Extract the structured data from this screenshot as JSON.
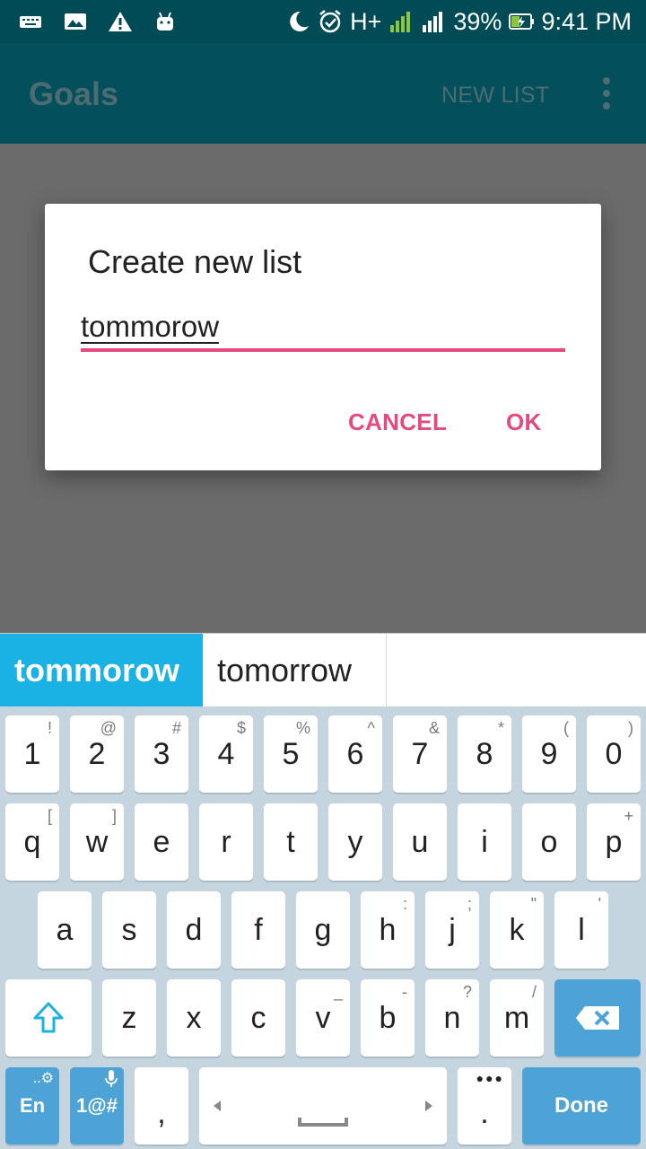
{
  "status_bar": {
    "battery": "39%",
    "time": "9:41 PM",
    "network": "H+",
    "sim1": "1",
    "sim2": "2",
    "icons_left": [
      "keyboard-icon",
      "image-icon",
      "warning-icon",
      "android-icon"
    ],
    "icons_right": [
      "moon-icon",
      "alarm-icon",
      "network-type-icon",
      "signal-icon",
      "signal-icon",
      "battery-charging-icon"
    ]
  },
  "app_bar": {
    "title": "Goals",
    "action": "NEW LIST",
    "menu_icon": "more-vert-icon"
  },
  "dialog": {
    "title": "Create new list",
    "input_value": "tommorow",
    "cancel_label": "CANCEL",
    "ok_label": "OK",
    "accent_color": "#e64980"
  },
  "suggestions": {
    "items": [
      "tommorow",
      "tomorrow"
    ],
    "highlight_color": "#1ab2e4"
  },
  "keyboard": {
    "row_numbers": [
      {
        "label": "1",
        "alt": "!"
      },
      {
        "label": "2",
        "alt": "@"
      },
      {
        "label": "3",
        "alt": "#"
      },
      {
        "label": "4",
        "alt": "$"
      },
      {
        "label": "5",
        "alt": "%"
      },
      {
        "label": "6",
        "alt": "^"
      },
      {
        "label": "7",
        "alt": "&"
      },
      {
        "label": "8",
        "alt": "*"
      },
      {
        "label": "9",
        "alt": "("
      },
      {
        "label": "0",
        "alt": ")"
      }
    ],
    "row_top": [
      {
        "label": "q",
        "alt": "["
      },
      {
        "label": "w",
        "alt": "]"
      },
      {
        "label": "e",
        "alt": ""
      },
      {
        "label": "r",
        "alt": ""
      },
      {
        "label": "t",
        "alt": ""
      },
      {
        "label": "y",
        "alt": ""
      },
      {
        "label": "u",
        "alt": ""
      },
      {
        "label": "i",
        "alt": ""
      },
      {
        "label": "o",
        "alt": ""
      },
      {
        "label": "p",
        "alt": "+"
      }
    ],
    "row_home": [
      {
        "label": "a",
        "alt": ""
      },
      {
        "label": "s",
        "alt": ""
      },
      {
        "label": "d",
        "alt": ""
      },
      {
        "label": "f",
        "alt": ""
      },
      {
        "label": "g",
        "alt": ""
      },
      {
        "label": "h",
        "alt": ":"
      },
      {
        "label": "j",
        "alt": ";"
      },
      {
        "label": "k",
        "alt": "\""
      },
      {
        "label": "l",
        "alt": "'"
      }
    ],
    "row_bottom": [
      {
        "label": "z",
        "alt": ""
      },
      {
        "label": "x",
        "alt": ""
      },
      {
        "label": "c",
        "alt": ""
      },
      {
        "label": "v",
        "alt": "_"
      },
      {
        "label": "b",
        "alt": "-"
      },
      {
        "label": "n",
        "alt": "?"
      },
      {
        "label": "m",
        "alt": "/"
      }
    ],
    "lang_label": "En",
    "symbols_label": "1@#",
    "comma_label": ",",
    "period_label": ".",
    "done_label": "Done",
    "key_blue": "#4ea3d6"
  }
}
